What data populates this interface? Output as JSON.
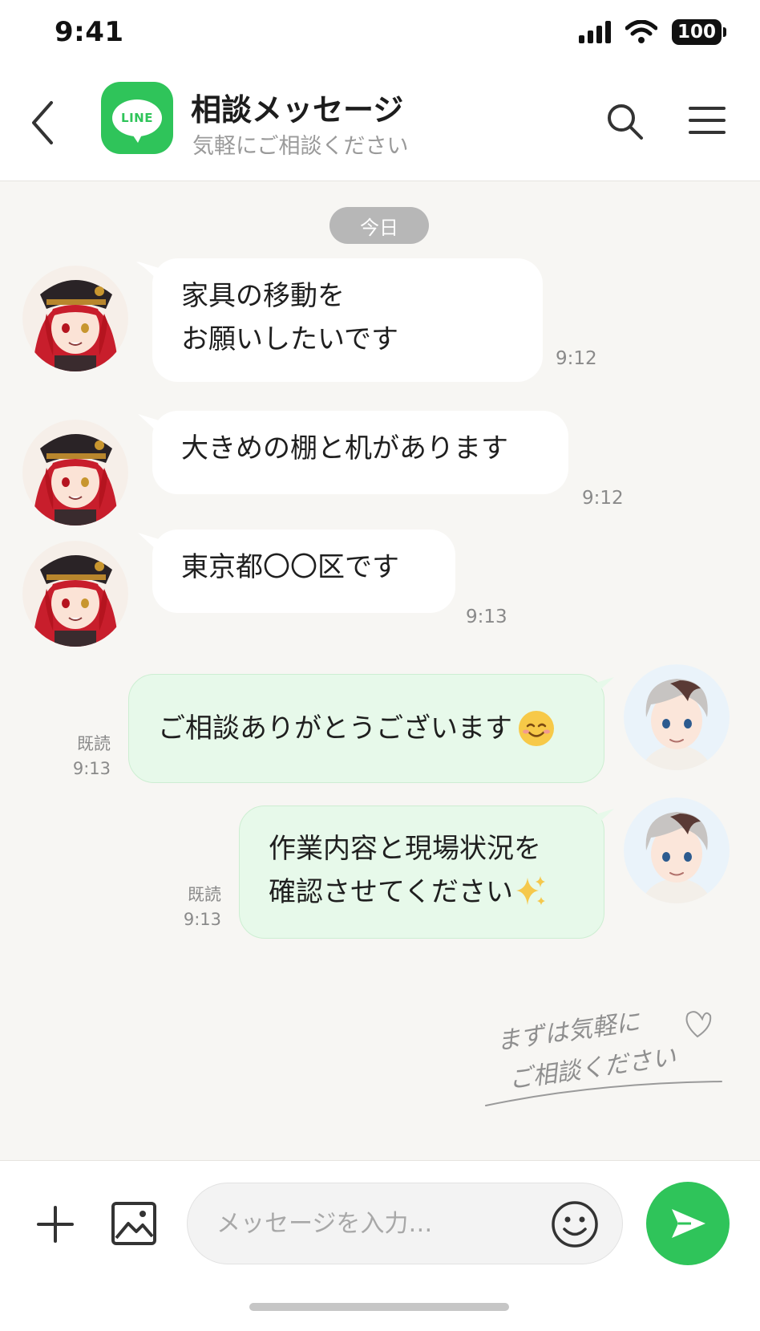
{
  "status_bar": {
    "time": "9:41",
    "battery": "100"
  },
  "header": {
    "logo_text": "LINE",
    "title": "相談メッセージ",
    "subtitle": "気軽にご相談ください"
  },
  "chat": {
    "date_label": "今日",
    "messages": [
      {
        "side": "in",
        "lines": [
          "家具の移動を",
          "お願いしたいです"
        ],
        "time": "9:12"
      },
      {
        "side": "in",
        "lines": [
          "大きめの棚と机があります"
        ],
        "time": "9:12"
      },
      {
        "side": "in",
        "lines": [
          "東京都〇〇区です"
        ],
        "time": "9:13"
      },
      {
        "side": "out",
        "lines": [
          "ご相談ありがとうございます"
        ],
        "read": "既読",
        "time": "9:13",
        "emoji": "smiling-face"
      },
      {
        "side": "out",
        "lines": [
          "作業内容と現場状況を",
          "確認させてください"
        ],
        "read": "既読",
        "time": "9:13",
        "emoji": "sparkles"
      }
    ],
    "handwritten_note": [
      "まずは気軽に",
      "ご相談ください"
    ]
  },
  "input": {
    "placeholder": "メッセージを入力…"
  },
  "colors": {
    "line_green": "#2fc45a",
    "outgoing_bubble": "#e7f9ea",
    "background": "#f7f6f3"
  }
}
